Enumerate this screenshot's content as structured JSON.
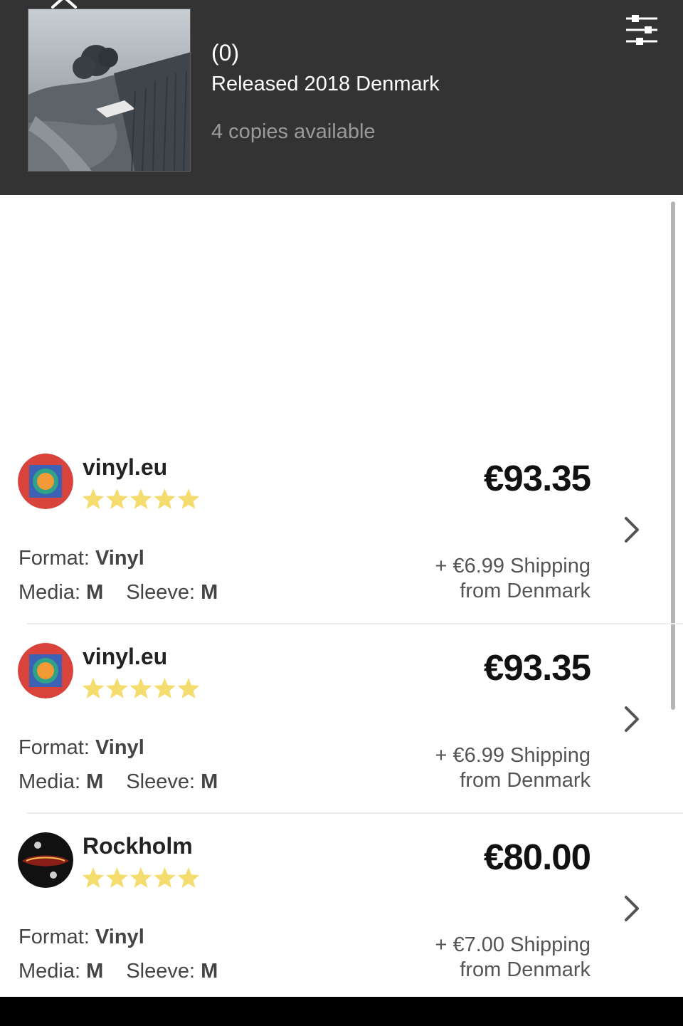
{
  "release": {
    "rating_count": "(0)",
    "released": "Released 2018 Denmark",
    "copies": "4 copies available"
  },
  "listings": [
    {
      "seller": "vinyl.eu",
      "rating_stars": 5,
      "price": "€93.35",
      "format_label": "Format:",
      "format_value": "Vinyl",
      "media_label": "Media:",
      "media_value": "M",
      "sleeve_label": "Sleeve:",
      "sleeve_value": "M",
      "shipping": "+ €6.99 Shipping",
      "from": "from Denmark",
      "avatar_icon": "vinyl-eu-logo-icon"
    },
    {
      "seller": "vinyl.eu",
      "rating_stars": 5,
      "price": "€93.35",
      "format_label": "Format:",
      "format_value": "Vinyl",
      "media_label": "Media:",
      "media_value": "M",
      "sleeve_label": "Sleeve:",
      "sleeve_value": "M",
      "shipping": "+ €6.99 Shipping",
      "from": "from Denmark",
      "avatar_icon": "vinyl-eu-logo-icon"
    },
    {
      "seller": "Rockholm",
      "rating_stars": 5,
      "price": "€80.00",
      "format_label": "Format:",
      "format_value": "Vinyl",
      "media_label": "Media:",
      "media_value": "M",
      "sleeve_label": "Sleeve:",
      "sleeve_value": "M",
      "shipping": "+ €7.00 Shipping",
      "from": "from Denmark",
      "avatar_icon": "rockholm-logo-icon"
    }
  ],
  "colors": {
    "header_bg": "#333333",
    "star": "#f5dc6e",
    "divider": "#ededed"
  },
  "icons": {
    "close": "close-icon",
    "filter": "sliders-icon",
    "chevron": "chevron-right-icon",
    "star": "star-icon"
  }
}
